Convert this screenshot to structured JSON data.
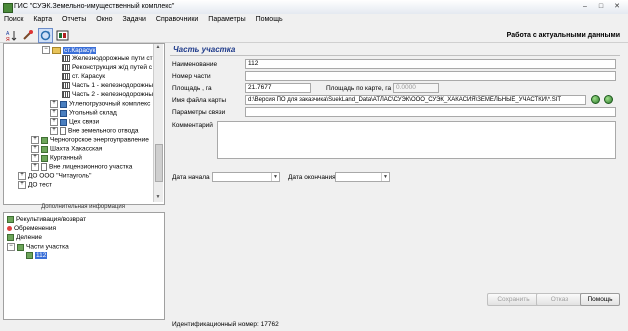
{
  "window": {
    "title": "ГИС \"СУЭК.Земельно-имущественный комплекс\"",
    "controls": [
      "–",
      "□",
      "✕"
    ]
  },
  "menu": [
    "Поиск",
    "Карта",
    "Отчеты",
    "Окно",
    "Задачи",
    "Справочники",
    "Параметры",
    "Помощь"
  ],
  "toolbar": {
    "status_text": "Работа с актуальными данными",
    "icons": [
      "sort-az-icon",
      "filter-icon",
      "refresh-icon",
      "grid-toggle-icon"
    ]
  },
  "tree": {
    "rows": [
      {
        "label": "ст.Карасук",
        "selected": true
      },
      {
        "label": "Железнодорожные пути ст"
      },
      {
        "label": "Реконструкция ж/д путей с"
      },
      {
        "label": "ст. Карасук"
      },
      {
        "label": "Часть 1 - железнодорожны"
      },
      {
        "label": "Часть 2 - железнодорожны"
      },
      {
        "label": "Углепогрузочный комплекс"
      },
      {
        "label": "Угольный склад"
      },
      {
        "label": "Цех связи"
      },
      {
        "label": "Вне земельного отвода"
      },
      {
        "label": "Черногорское энергоуправление"
      },
      {
        "label": "Шахта Хакасская"
      },
      {
        "label": "Курганный"
      },
      {
        "label": "Вне лицензионного участка"
      },
      {
        "label": "ДО ООО \"Читауголь\""
      },
      {
        "label": "ДО тест"
      }
    ]
  },
  "divider_label": "Дополнительная информация",
  "lower_tree": [
    {
      "label": "Рекультивация/возврат"
    },
    {
      "label": "Обременения"
    },
    {
      "label": "Деление"
    },
    {
      "label": "Части участка"
    },
    {
      "label": "112",
      "selected": true
    }
  ],
  "form": {
    "section_title": "Часть участка",
    "name_label": "Наименование",
    "name_value": "112",
    "part_number_label": "Номер части",
    "part_number_value": "",
    "area_label": "Площадь , га",
    "area_value": "21.7677",
    "area_map_label": "Площадь по карте, га",
    "area_map_value": "0.0000",
    "map_file_label": "Имя файла  карты",
    "map_file_value": "d:\\Версия ПО для заказчика\\SuekLand_Data\\АТЛАС\\СУЭК\\ООО_СУЭК_ХАКАСИЯ\\ЗЕМЕЛЬНЫЕ_УЧАСТКИ\\*.SIT",
    "link_params_label": "Параметры связи",
    "link_params_value": "",
    "comment_label": "Комментарий",
    "comment_value": "",
    "start_date_label": "Дата начала",
    "start_date_value": "",
    "end_date_label": "Дата окончания",
    "end_date_value": ""
  },
  "buttons": {
    "save": "Сохранить",
    "cancel": "Отказ",
    "help": "Помощь"
  },
  "footer": {
    "id_text": "Идентификационный номер: 17762"
  }
}
